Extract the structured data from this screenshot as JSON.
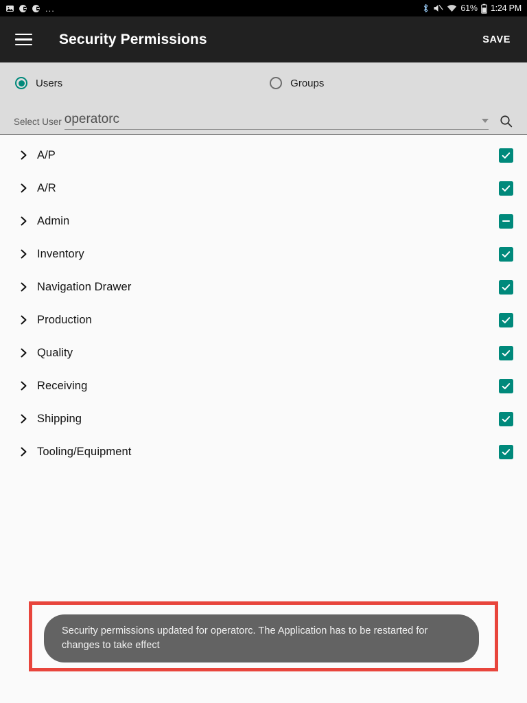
{
  "status_bar": {
    "left_icons": [
      {
        "name": "image-icon",
        "glyph": "Ὓb"
      },
      {
        "name": "contacts-icon",
        "glyph": "◖"
      },
      {
        "name": "contacts-icon-2",
        "glyph": "◖"
      }
    ],
    "overflow": "...",
    "bluetooth_icon": "bluetooth-icon",
    "mute_icon": "volume-mute-icon",
    "wifi_icon": "wifi-icon",
    "battery_percent": "61%",
    "battery_icon": "battery-icon",
    "clock": "1:24 PM"
  },
  "app_bar": {
    "menu_icon": "hamburger-menu-icon",
    "title": "Security Permissions",
    "save_label": "SAVE"
  },
  "selector": {
    "radios": [
      {
        "label": "Users",
        "selected": true
      },
      {
        "label": "Groups",
        "selected": false
      }
    ],
    "select_user_label": "Select User",
    "selected_user": "operatorc",
    "dropdown_icon": "chevron-down-icon",
    "search_icon": "search-icon"
  },
  "permissions": {
    "rows": [
      {
        "label": "A/P",
        "state": "checked"
      },
      {
        "label": "A/R",
        "state": "checked"
      },
      {
        "label": "Admin",
        "state": "indeterminate"
      },
      {
        "label": "Inventory",
        "state": "checked"
      },
      {
        "label": "Navigation Drawer",
        "state": "checked"
      },
      {
        "label": "Production",
        "state": "checked"
      },
      {
        "label": "Quality",
        "state": "checked"
      },
      {
        "label": "Receiving",
        "state": "checked"
      },
      {
        "label": "Shipping",
        "state": "checked"
      },
      {
        "label": "Tooling/Equipment",
        "state": "checked"
      }
    ]
  },
  "toast": {
    "message": "Security permissions updated for operatorc. The Application has to be restarted for changes to take effect"
  },
  "colors": {
    "accent": "#00897b",
    "app_bar": "#212121",
    "panel": "#dcdcdc",
    "annotation": "#e8453c",
    "toast_bg": "#636363"
  }
}
